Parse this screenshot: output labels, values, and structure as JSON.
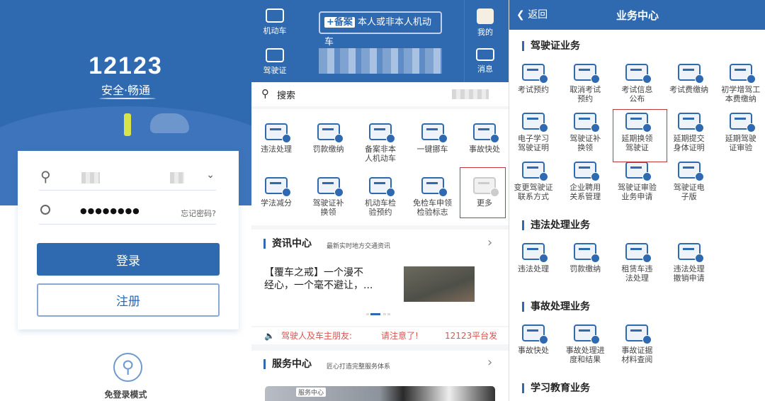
{
  "login": {
    "logo": "12123",
    "slogan": "安全·畅通",
    "password_mask": "●●●●●●●●",
    "forgot_password": "忘记密码?",
    "login_button": "登录",
    "register_button": "注册",
    "guest_mode": "免登录模式"
  },
  "home": {
    "header": {
      "vehicle_label": "机动车",
      "license_label": "驾驶证",
      "register_badge": "+备案",
      "register_text": "本人或非本人机动车",
      "mine_label": "我的",
      "message_label": "消息"
    },
    "search_label": "搜索",
    "grid": [
      {
        "label": "违法处理",
        "line2": ""
      },
      {
        "label": "罚款缴纳",
        "line2": ""
      },
      {
        "label": "备案非本",
        "line2": "人机动车"
      },
      {
        "label": "一键挪车",
        "line2": ""
      },
      {
        "label": "事故快处",
        "line2": ""
      },
      {
        "label": "学法减分",
        "line2": ""
      },
      {
        "label": "驾驶证补",
        "line2": "换领"
      },
      {
        "label": "机动车检",
        "line2": "验预约"
      },
      {
        "label": "免检车申领",
        "line2": "检验标志"
      },
      {
        "label": "更多",
        "line2": ""
      }
    ],
    "news": {
      "title": "资讯中心",
      "subtitle": "最新实时地方交通资讯",
      "headline_1": "【覆车之戒】一个漫不",
      "headline_2": "经心，一个毫不避让，..."
    },
    "notice": {
      "part1": "驾驶人及车主朋友:",
      "part2": "请注意了!",
      "part3": "12123平台发"
    },
    "service": {
      "title": "服务中心",
      "subtitle": "匠心打造完整服务体系",
      "image_tag": "服务中心"
    }
  },
  "business": {
    "back": "返回",
    "title": "业务中心",
    "sections": [
      {
        "title": "驾驶证业务",
        "items": [
          [
            "考试预约",
            ""
          ],
          [
            "取消考试",
            "预约"
          ],
          [
            "考试信息",
            "公布"
          ],
          [
            "考试费缴纳",
            ""
          ],
          [
            "初学增驾工",
            "本费缴纳"
          ],
          [
            "电子学习",
            "驾驶证明"
          ],
          [
            "驾驶证补",
            "换领"
          ],
          [
            "延期换领",
            "驾驶证"
          ],
          [
            "延期提交",
            "身体证明"
          ],
          [
            "延期驾驶",
            "证审验"
          ],
          [
            "变更驾驶证",
            "联系方式"
          ],
          [
            "企业聘用",
            "关系管理"
          ],
          [
            "驾驶证审验",
            "业务申请"
          ],
          [
            "驾驶证电",
            "子版"
          ]
        ]
      },
      {
        "title": "违法处理业务",
        "items": [
          [
            "违法处理",
            ""
          ],
          [
            "罚款缴纳",
            ""
          ],
          [
            "租赁车违",
            "法处理"
          ],
          [
            "违法处理",
            "撤销申请"
          ]
        ]
      },
      {
        "title": "事故处理业务",
        "items": [
          [
            "事故快处",
            ""
          ],
          [
            "事故处理进",
            "度和结果"
          ],
          [
            "事故证据",
            "材料查阅"
          ]
        ]
      },
      {
        "title": "学习教育业务",
        "items": []
      }
    ]
  },
  "colors": {
    "brand": "#2f69b0",
    "highlight": "#c2393b",
    "notice": "#d9534f"
  }
}
